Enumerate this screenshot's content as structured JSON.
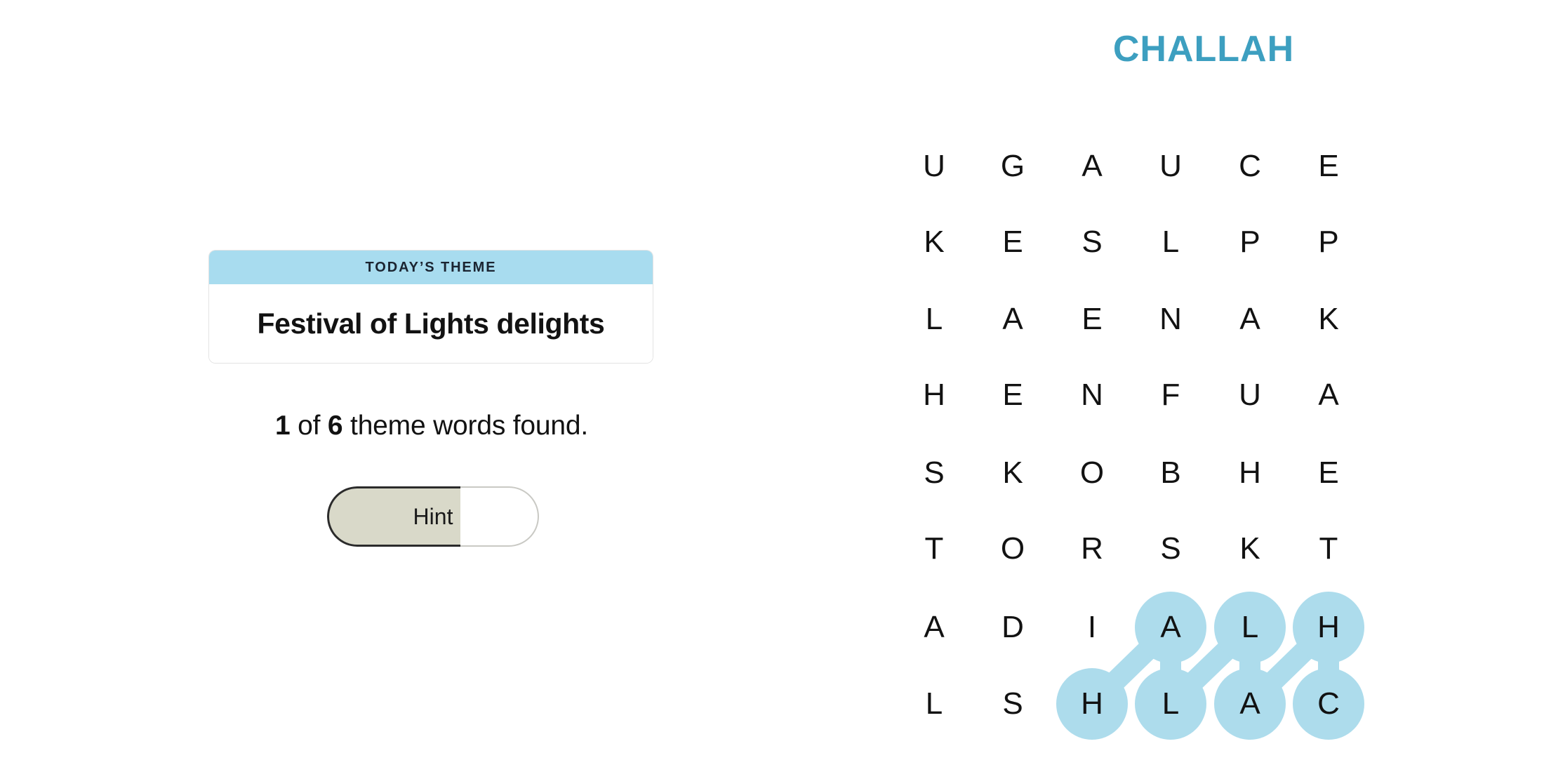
{
  "puzzle": {
    "title": "CHALLAH",
    "title_color": "#3d9fc0",
    "highlight_color": "#addcec",
    "grid": [
      [
        "U",
        "G",
        "A",
        "U",
        "C",
        "E"
      ],
      [
        "K",
        "E",
        "S",
        "L",
        "P",
        "P"
      ],
      [
        "L",
        "A",
        "E",
        "N",
        "A",
        "K"
      ],
      [
        "H",
        "E",
        "N",
        "F",
        "U",
        "A"
      ],
      [
        "S",
        "K",
        "O",
        "B",
        "H",
        "E"
      ],
      [
        "T",
        "O",
        "R",
        "S",
        "K",
        "T"
      ],
      [
        "A",
        "D",
        "I",
        "A",
        "L",
        "H"
      ],
      [
        "L",
        "S",
        "H",
        "L",
        "A",
        "C"
      ]
    ],
    "found_word_path": [
      {
        "row": 7,
        "col": 2,
        "letter": "H"
      },
      {
        "row": 6,
        "col": 3,
        "letter": "A"
      },
      {
        "row": 7,
        "col": 3,
        "letter": "L"
      },
      {
        "row": 6,
        "col": 4,
        "letter": "L"
      },
      {
        "row": 7,
        "col": 4,
        "letter": "A"
      },
      {
        "row": 6,
        "col": 5,
        "letter": "H"
      },
      {
        "row": 7,
        "col": 5,
        "letter": "C"
      }
    ]
  },
  "theme_card": {
    "header_label": "TODAY’S THEME",
    "theme_text": "Festival of Lights delights",
    "header_bg": "#a8dcef"
  },
  "progress": {
    "found_count": "1",
    "total_count": "6",
    "prefix": "",
    "middle": " of ",
    "suffix": " theme words found."
  },
  "hint": {
    "label": "Hint",
    "fill_percent": "63",
    "fill_color": "#d9d9c9"
  }
}
